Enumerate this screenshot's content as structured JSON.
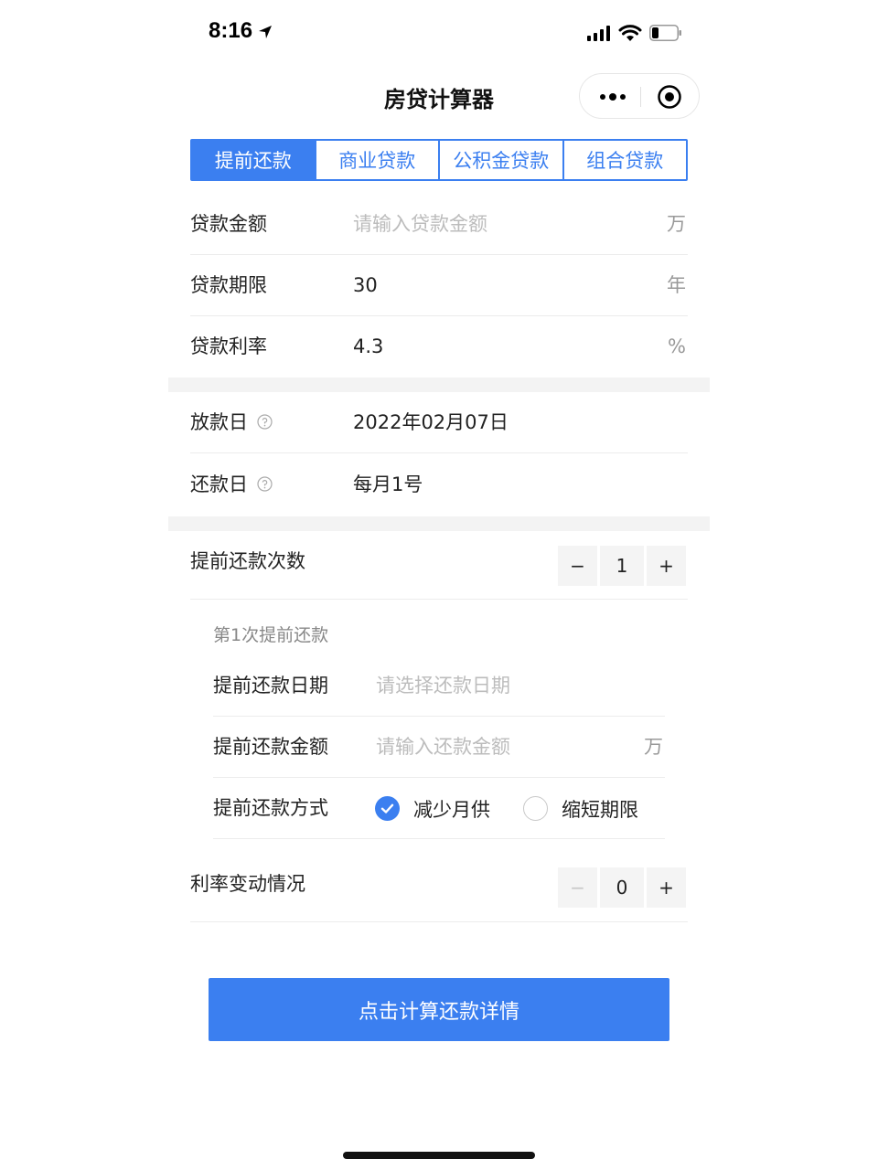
{
  "status_bar": {
    "time": "8:16"
  },
  "nav": {
    "title": "房贷计算器"
  },
  "tabs": [
    {
      "label": "提前还款",
      "active": true
    },
    {
      "label": "商业贷款",
      "active": false
    },
    {
      "label": "公积金贷款",
      "active": false
    },
    {
      "label": "组合贷款",
      "active": false
    }
  ],
  "loan": {
    "amount": {
      "label": "贷款金额",
      "value": "",
      "placeholder": "请输入贷款金额",
      "unit": "万"
    },
    "term": {
      "label": "贷款期限",
      "value": "30",
      "unit": "年"
    },
    "rate": {
      "label": "贷款利率",
      "value": "4.3",
      "unit": "%"
    }
  },
  "dates": {
    "disburse": {
      "label": "放款日",
      "value": "2022年02月07日"
    },
    "repay": {
      "label": "还款日",
      "value": "每月1号"
    }
  },
  "prepay_count": {
    "label": "提前还款次数",
    "minus": "−",
    "count": "1",
    "plus": "+"
  },
  "prepay_1": {
    "title": "第1次提前还款",
    "date": {
      "label": "提前还款日期",
      "placeholder": "请选择还款日期"
    },
    "amount": {
      "label": "提前还款金额",
      "placeholder": "请输入还款金额",
      "unit": "万"
    },
    "method": {
      "label": "提前还款方式",
      "options": [
        {
          "label": "减少月供",
          "checked": true
        },
        {
          "label": "缩短期限",
          "checked": false
        }
      ]
    }
  },
  "rate_change": {
    "label": "利率变动情况",
    "minus": "−",
    "count": "0",
    "plus": "+"
  },
  "calc_button": {
    "label": "点击计算还款详情"
  },
  "colors": {
    "accent": "#3b7ff0",
    "placeholder": "#bcbcbc"
  }
}
